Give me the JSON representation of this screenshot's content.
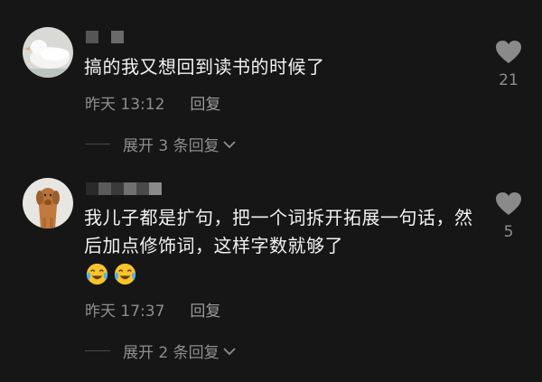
{
  "colors": {
    "background": "#161616",
    "text_primary": "#f2f2f2",
    "text_secondary": "#8e8e8e",
    "heart": "#8a8a8a"
  },
  "comments": [
    {
      "text": "搞的我又想回到读书的时候了",
      "time": "昨天 13:12",
      "reply_label": "回复",
      "expand_label": "展开 3 条回复",
      "like_count": "21",
      "avatar_icon": "white-bird-avatar",
      "emojis": []
    },
    {
      "text": "我儿子都是扩句，把一个词拆开拓展一句话，然后加点修饰词，这样字数就够了",
      "time": "昨天 17:37",
      "reply_label": "回复",
      "expand_label": "展开 2 条回复",
      "like_count": "5",
      "avatar_icon": "golden-retriever-avatar",
      "emojis": [
        "crying-laughing-emoji",
        "crying-laughing-emoji"
      ]
    }
  ]
}
